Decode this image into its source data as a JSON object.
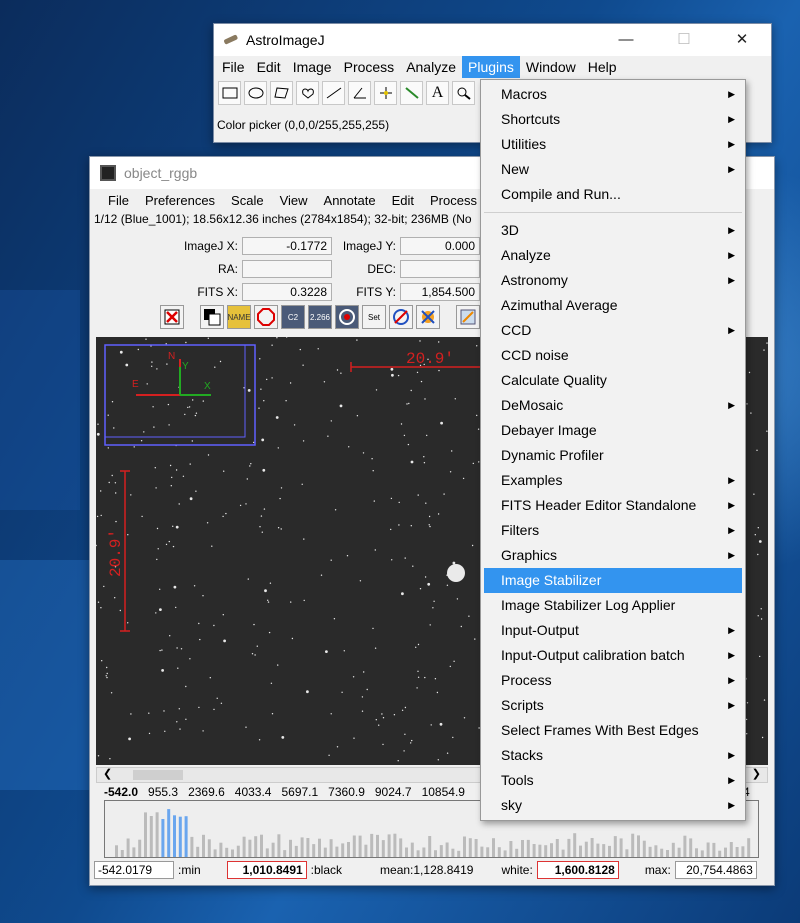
{
  "main_window": {
    "title": "AstroImageJ",
    "controls": {
      "minimize": "—",
      "maximize": "☐",
      "close": "✕"
    },
    "menu": [
      "File",
      "Edit",
      "Image",
      "Process",
      "Analyze",
      "Plugins",
      "Window",
      "Help"
    ],
    "active_menu": "Plugins",
    "status": "Color picker (0,0,0/255,255,255)"
  },
  "image_window": {
    "title": "object_rggb",
    "menu": [
      "File",
      "Preferences",
      "Scale",
      "View",
      "Annotate",
      "Edit",
      "Process"
    ],
    "info": "1/12 (Blue_1001); 18.56x12.36 inches (2784x1854); 32-bit; 236MB (No",
    "coords": {
      "imagej_x_label": "ImageJ X:",
      "imagej_x": "-0.1772",
      "imagej_y_label": "ImageJ Y:",
      "imagej_y": "0.000",
      "ra_label": "RA:",
      "ra": "",
      "dec_label": "DEC:",
      "dec": "",
      "fits_x_label": "FITS X:",
      "fits_x": "0.3228",
      "fits_y_label": "FITS Y:",
      "fits_y": "1,854.500"
    },
    "icon_labels": {
      "name": "NAME",
      "c2": "C2",
      "c266": "2.266",
      "set": "Set"
    },
    "overlay": {
      "measure_h": "20.9'",
      "measure_v": "20.9'",
      "north": "N",
      "east": "E",
      "y": "Y",
      "x": "X"
    },
    "ticks": [
      "-542.0",
      "955.3",
      "2369.6",
      "4033.4",
      "5697.1",
      "7360.9",
      "9024.7",
      "10854.9",
      "4"
    ],
    "bottom": {
      "min": "-542.0179",
      "min_label": ":min",
      "black": "1,010.8491",
      "black_label": ":black",
      "mean": "mean:1,128.8419",
      "white_label": "white:",
      "white": "1,600.8128",
      "max_label": "max:",
      "max": "20,754.4863"
    }
  },
  "plugins_menu": [
    {
      "label": "Macros",
      "sub": true
    },
    {
      "label": "Shortcuts",
      "sub": true
    },
    {
      "label": "Utilities",
      "sub": true
    },
    {
      "label": "New",
      "sub": true
    },
    {
      "label": "Compile and Run...",
      "sub": false
    },
    {
      "sep": true
    },
    {
      "label": "3D",
      "sub": true
    },
    {
      "label": "Analyze",
      "sub": true
    },
    {
      "label": "Astronomy",
      "sub": true
    },
    {
      "label": "Azimuthal Average",
      "sub": false
    },
    {
      "label": "CCD",
      "sub": true
    },
    {
      "label": "CCD noise",
      "sub": false
    },
    {
      "label": "Calculate Quality",
      "sub": false
    },
    {
      "label": "DeMosaic",
      "sub": true
    },
    {
      "label": "Debayer Image",
      "sub": false
    },
    {
      "label": "Dynamic Profiler",
      "sub": false
    },
    {
      "label": "Examples",
      "sub": true
    },
    {
      "label": "FITS Header Editor Standalone",
      "sub": true
    },
    {
      "label": "Filters",
      "sub": true
    },
    {
      "label": "Graphics",
      "sub": true
    },
    {
      "label": "Image Stabilizer",
      "sub": false,
      "highlighted": true
    },
    {
      "label": "Image Stabilizer Log Applier",
      "sub": false
    },
    {
      "label": "Input-Output",
      "sub": true
    },
    {
      "label": "Input-Output calibration batch",
      "sub": true
    },
    {
      "label": "Process",
      "sub": true
    },
    {
      "label": "Scripts",
      "sub": true
    },
    {
      "label": "Select Frames With Best Edges",
      "sub": false
    },
    {
      "label": "Stacks",
      "sub": true
    },
    {
      "label": "Tools",
      "sub": true
    },
    {
      "label": "sky",
      "sub": true
    }
  ],
  "colors": {
    "highlight": "#3394ef",
    "overlay_red": "#d42020",
    "overlay_green": "#22aa22",
    "overlay_blue": "#6060ff"
  }
}
